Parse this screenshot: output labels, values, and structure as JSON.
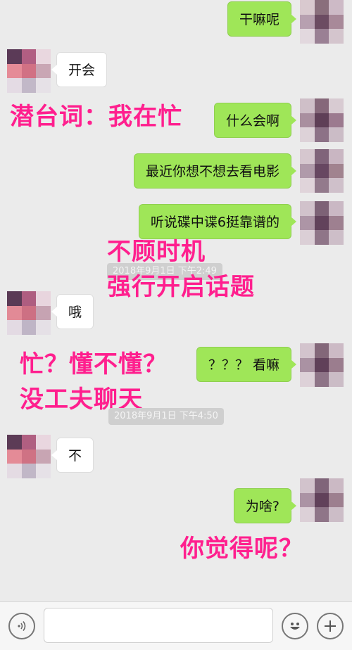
{
  "messages": [
    {
      "text": "干嘛呢"
    },
    {
      "text": "开会"
    },
    {
      "text": "什么会啊"
    },
    {
      "text": "最近你想不想去看电影"
    },
    {
      "text": "听说碟中谍6挺靠谱的"
    },
    {
      "text": "哦"
    },
    {
      "text": "？？？ 看嘛"
    },
    {
      "text": "不"
    },
    {
      "text": "为啥?"
    }
  ],
  "timestamps": [
    "2018年9月1日 下午2:49",
    "2018年9月1日 下午4:50"
  ],
  "annotations": [
    "潜台词：我在忙",
    "不顾时机",
    "强行开启话题",
    "忙？懂不懂？",
    "没工夫聊天",
    "你觉得呢？"
  ],
  "input_bar": {
    "placeholder": "",
    "voice_icon": "voice-icon",
    "emoji_icon": "emoji-icon",
    "plus_icon": "plus-icon"
  },
  "colors": {
    "annotation": "#ff1f8e",
    "bubble_out": "#9fe658",
    "bubble_in": "#ffffff",
    "background": "#ebebeb"
  }
}
